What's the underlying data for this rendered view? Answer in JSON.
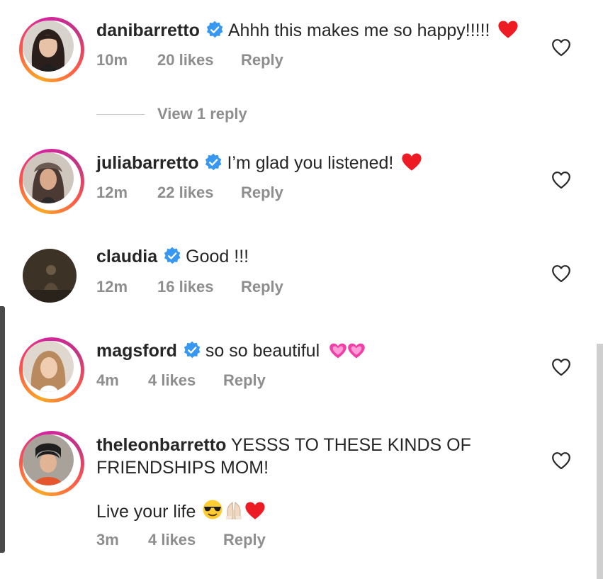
{
  "comments": [
    {
      "username": "danibarretto",
      "verified": true,
      "text": "Ahhh this makes me so happy!!!!!",
      "emoji": "red-heart",
      "time": "10m",
      "likes": "20 likes",
      "reply_label": "Reply"
    },
    {
      "username": "juliabarretto",
      "verified": true,
      "text": "I’m glad you listened!",
      "emoji": "red-heart",
      "time": "12m",
      "likes": "22 likes",
      "reply_label": "Reply"
    },
    {
      "username": "claudia",
      "verified": true,
      "text": "Good !!!",
      "time": "12m",
      "likes": "16 likes",
      "reply_label": "Reply"
    },
    {
      "username": "magsford",
      "verified": true,
      "text": "so so beautiful",
      "emoji": "two-pink-hearts",
      "time": "4m",
      "likes": "4 likes",
      "reply_label": "Reply"
    },
    {
      "username": "theleonbarretto",
      "verified": false,
      "text_line1": "YESSS TO THESE KINDS OF",
      "text_line2": "FRIENDSHIPS MOM!",
      "text_line3": "Live your life",
      "emoji": "sunglasses-praying-hands-red-heart",
      "time": "3m",
      "likes": "4 likes",
      "reply_label": "Reply"
    }
  ],
  "view_replies": "View 1 reply",
  "colors": {
    "text": "#262626",
    "meta": "#8e8e8e",
    "verified": "#3897f0",
    "heart": "#ed4956"
  }
}
